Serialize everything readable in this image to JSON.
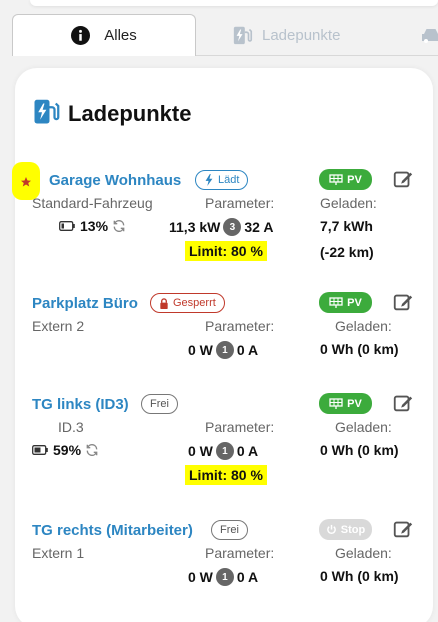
{
  "tabs": [
    {
      "label": "Alles",
      "active": true,
      "icon": "info-icon"
    },
    {
      "label": "Ladepunkte",
      "active": false,
      "icon": "charger-icon"
    },
    {
      "label": "",
      "active": false,
      "icon": "car-icon"
    }
  ],
  "card": {
    "title": "Ladepunkte",
    "icon": "charging-station-icon"
  },
  "labels": {
    "parameter": "Parameter:",
    "geladen": "Geladen:"
  },
  "colors": {
    "link": "#2d86c2",
    "pv": "#3cab3c",
    "gesperrt": "#c0392b",
    "highlight": "#ffff00"
  },
  "chargepoints": [
    {
      "name": "Garage Wohnhaus",
      "favorite": true,
      "status": "Lädt",
      "mode": "PV",
      "vehicle": "Standard-Fahrzeug",
      "soc": "13%",
      "power": "11,3 kW",
      "phases": "3",
      "current": "32 A",
      "energy": "7,7 kWh",
      "range": "(-22 km)",
      "limit": "Limit: 80 %"
    },
    {
      "name": "Parkplatz Büro",
      "status": "Gesperrt",
      "mode": "PV",
      "vehicle": "Extern 2",
      "power": "0 W",
      "phases": "1",
      "current": "0 A",
      "energy": "0 Wh (0 km)"
    },
    {
      "name": "TG links (ID3)",
      "status": "Frei",
      "mode": "PV",
      "vehicle": "ID.3",
      "soc": "59%",
      "power": "0 W",
      "phases": "1",
      "current": "0 A",
      "energy": "0 Wh (0 km)",
      "limit": "Limit: 80 %"
    },
    {
      "name": "TG rechts (Mitarbeiter)",
      "status": "Frei",
      "mode": "Stop",
      "vehicle": "Extern 1",
      "power": "0 W",
      "phases": "1",
      "current": "0 A",
      "energy": "0 Wh (0 km)"
    }
  ]
}
